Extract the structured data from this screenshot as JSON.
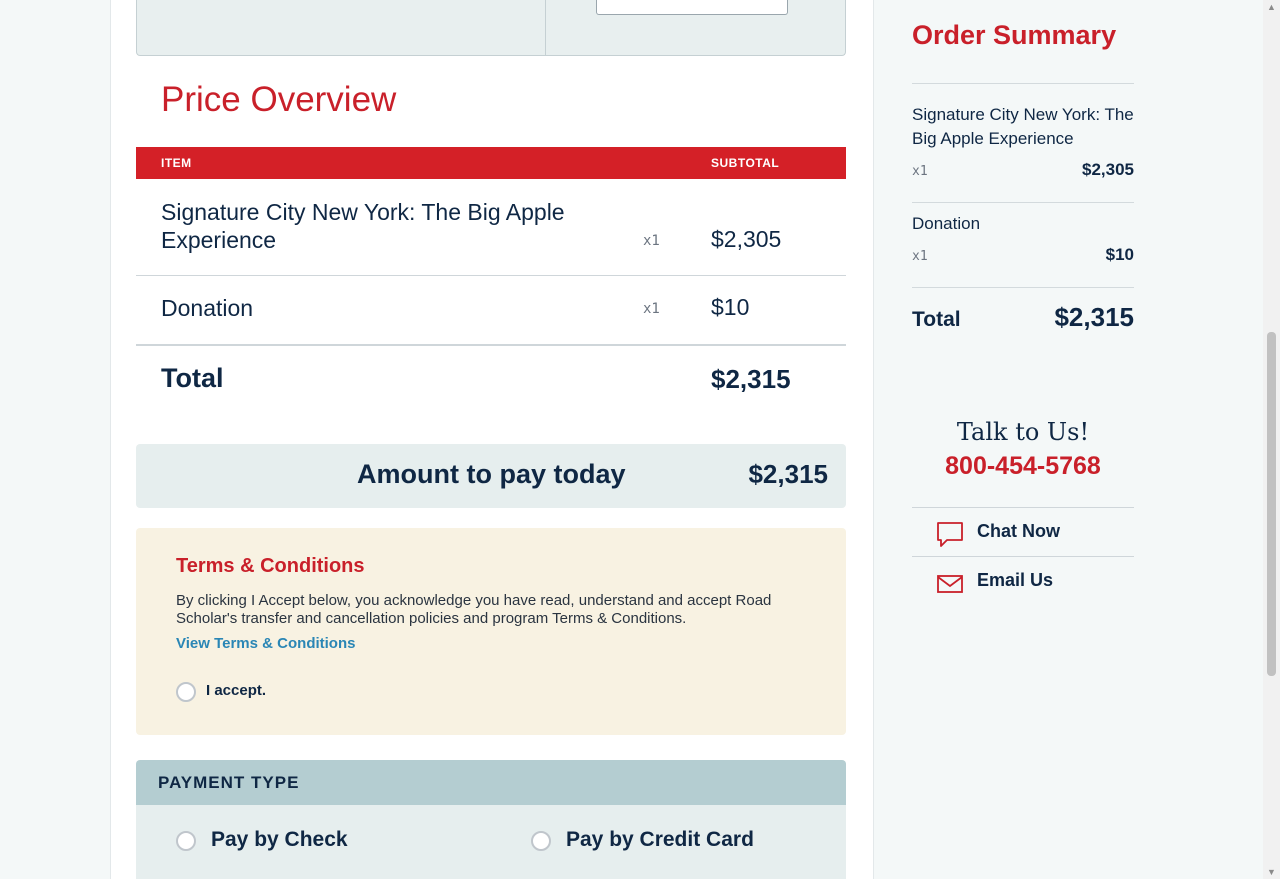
{
  "price_overview": {
    "title": "Price Overview",
    "columns": {
      "item": "ITEM",
      "subtotal": "SUBTOTAL"
    },
    "rows": [
      {
        "name": "Signature City New York: The Big Apple Experience",
        "qty": "x1",
        "amount": "$2,305"
      },
      {
        "name": "Donation",
        "qty": "x1",
        "amount": "$10"
      }
    ],
    "total_label": "Total",
    "total_amount": "$2,315"
  },
  "amount_today": {
    "label": "Amount to pay today",
    "amount": "$2,315"
  },
  "terms": {
    "title": "Terms & Conditions",
    "text": "By clicking I Accept below, you acknowledge you have read, understand and accept Road Scholar's transfer and cancellation policies and program Terms & Conditions.",
    "link": "View Terms & Conditions",
    "accept_label": "I accept."
  },
  "payment": {
    "header": "PAYMENT TYPE",
    "options": [
      {
        "label": "Pay by Check"
      },
      {
        "label": "Pay by Credit Card"
      }
    ]
  },
  "order_summary": {
    "title": "Order Summary",
    "items": [
      {
        "name": "Signature City New York: The Big Apple Experience",
        "qty": "x1",
        "amount": "$2,305"
      },
      {
        "name": "Donation",
        "qty": "x1",
        "amount": "$10"
      }
    ],
    "total_label": "Total",
    "total_amount": "$2,315"
  },
  "contact": {
    "talk": "Talk to Us!",
    "phone": "800-454-5768",
    "chat": "Chat Now",
    "email": "Email Us"
  },
  "colors": {
    "brand_red": "#c9202a",
    "navy": "#0f2744",
    "link_blue": "#2a86b5"
  },
  "icons": [
    "chat-bubble-icon",
    "envelope-icon",
    "scroll-up-arrow",
    "scroll-down-arrow"
  ]
}
